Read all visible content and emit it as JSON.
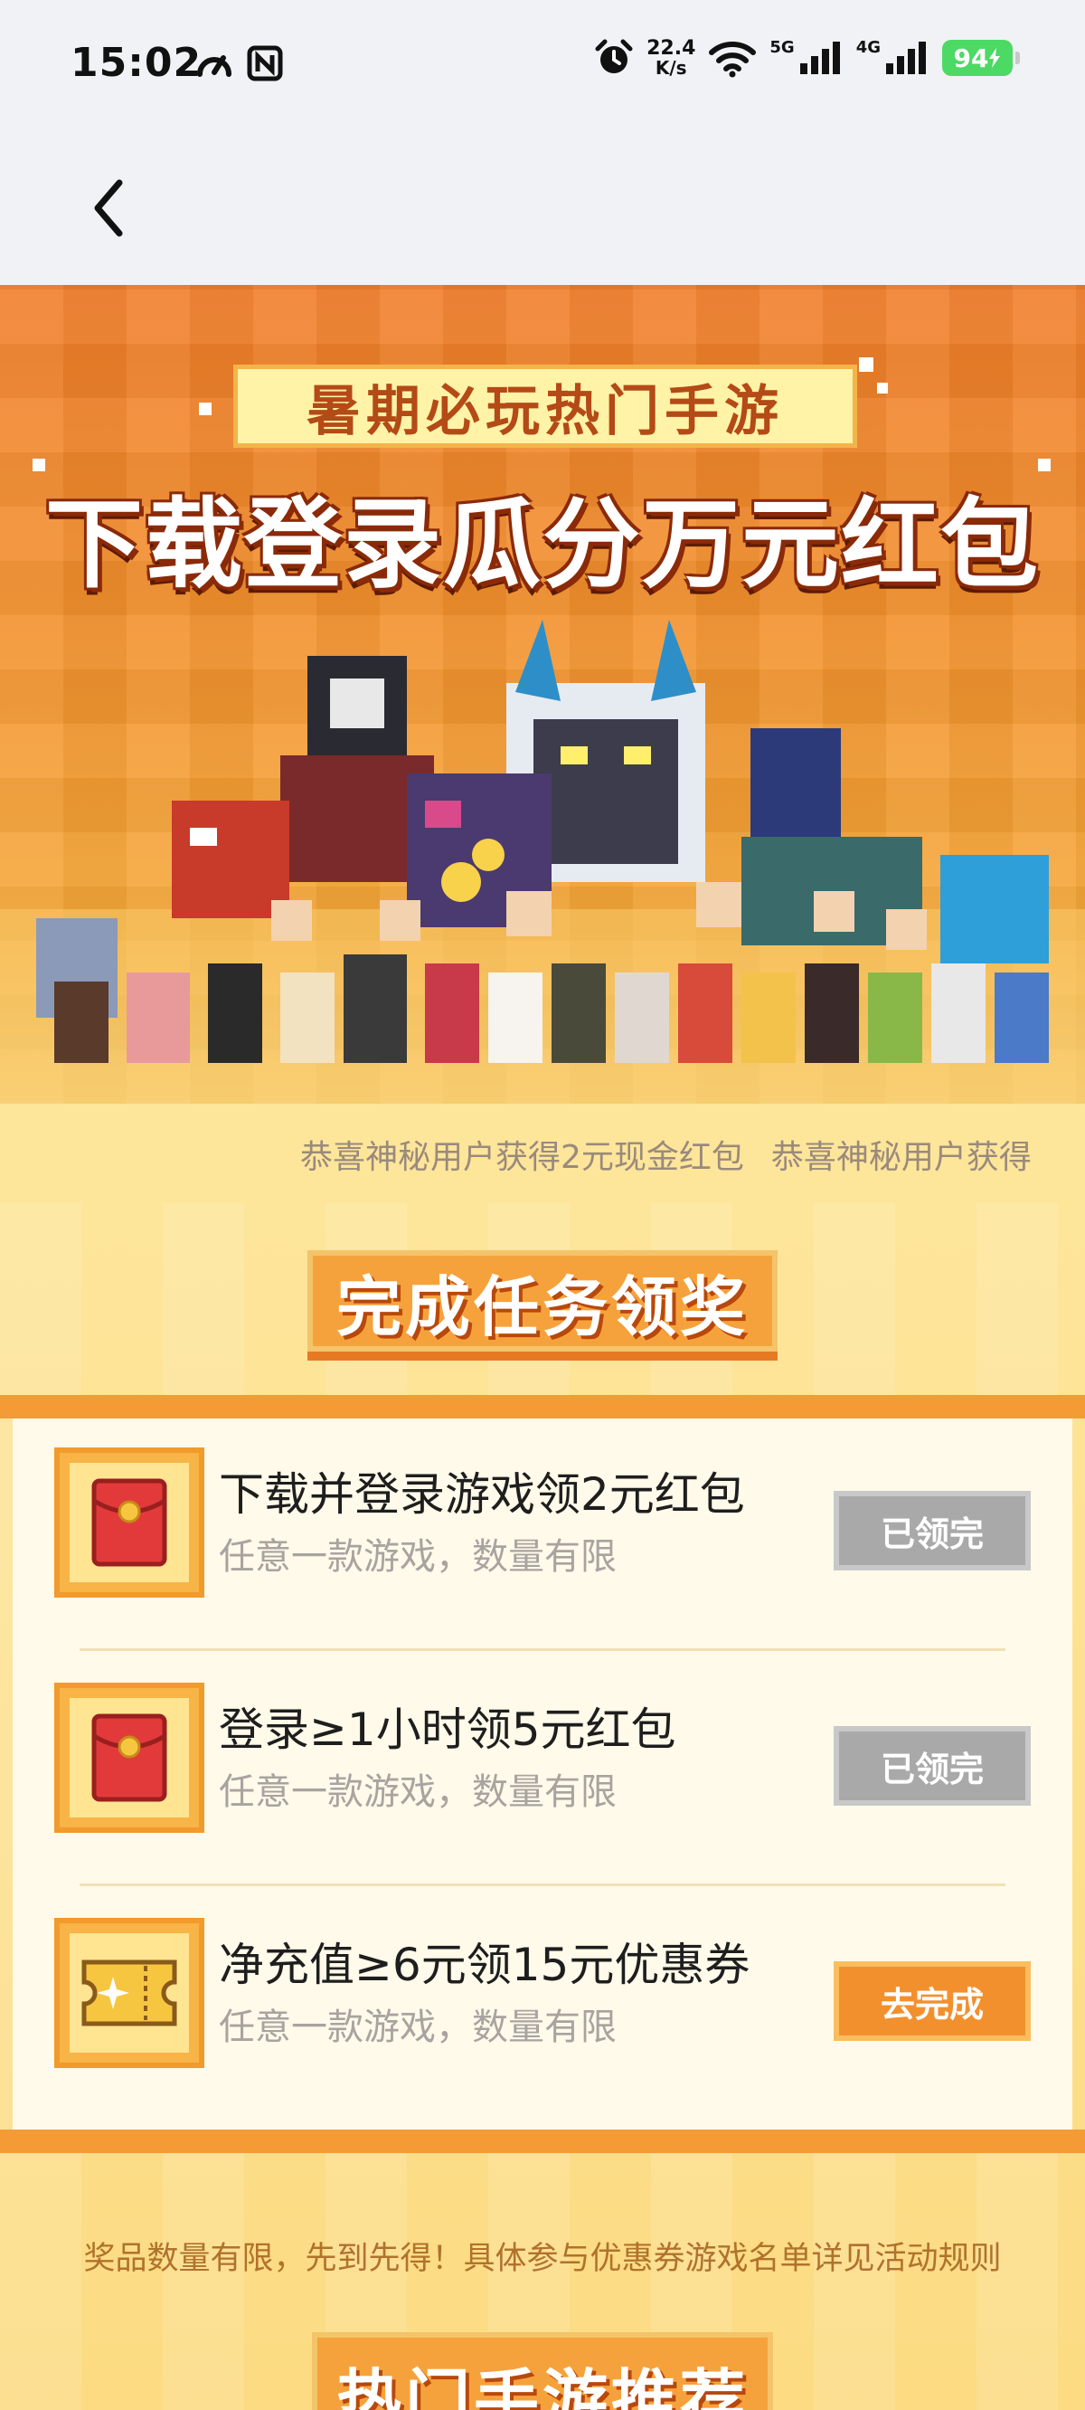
{
  "status_bar": {
    "time": "15:02",
    "net_speed_value": "22.4",
    "net_speed_unit": "K/s",
    "signal1_label": "5G",
    "signal2_label": "4G",
    "battery": "94",
    "battery_color": "#4cd964"
  },
  "nav": {
    "back_icon": "chevron-left-icon"
  },
  "hero": {
    "subtitle": "暑期必玩热门手游",
    "title": "下载登录瓜分万元红包"
  },
  "ticker": {
    "items": [
      "恭喜神秘用户获得2元现金红包",
      "恭喜神秘用户获得"
    ]
  },
  "tasks": {
    "section_title": "完成任务领奖",
    "items": [
      {
        "icon": "red-envelope-icon",
        "title": "下载并登录游戏领2元红包",
        "desc": "任意一款游戏，数量有限",
        "button": "已领完",
        "state": "done"
      },
      {
        "icon": "red-envelope-icon",
        "title": "登录≥1小时领5元红包",
        "desc": "任意一款游戏，数量有限",
        "button": "已领完",
        "state": "done"
      },
      {
        "icon": "coupon-ticket-icon",
        "title": "净充值≥6元领15元优惠券",
        "desc": "任意一款游戏，数量有限",
        "button": "去完成",
        "state": "active"
      }
    ],
    "notice": "奖品数量有限，先到先得！具体参与优惠券游戏名单详见活动规则"
  },
  "hot": {
    "section_title": "热门手游推荐"
  },
  "colors": {
    "accent": "#f3902e",
    "banner": "#f07d2a",
    "disabled": "#a9a9a9"
  }
}
